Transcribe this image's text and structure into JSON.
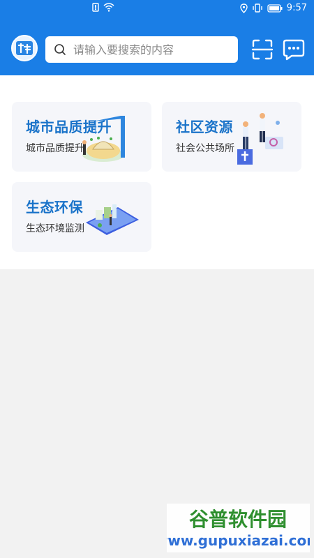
{
  "status_bar": {
    "time": "9:57"
  },
  "header": {
    "logo_icon": "app-logo",
    "search": {
      "placeholder": "请输入要搜索的内容"
    },
    "scan_icon": "scan-icon",
    "message_icon": "message-icon"
  },
  "cards": [
    {
      "title": "城市品质提升",
      "subtitle": "城市品质提升",
      "icon": "crane-illustration"
    },
    {
      "title": "社区资源",
      "subtitle": "社会公共场所",
      "icon": "doctors-illustration"
    },
    {
      "title": "生态环保",
      "subtitle": "生态环境监测",
      "icon": "tablet-illustration"
    }
  ],
  "watermark": {
    "title": "谷普软件园",
    "url": "www.gupuxiazai.com"
  },
  "colors": {
    "primary": "#1a7ee6",
    "card_title": "#1a73c9",
    "card_bg": "#f5f6fa",
    "page_bg": "#f2f2f2"
  }
}
